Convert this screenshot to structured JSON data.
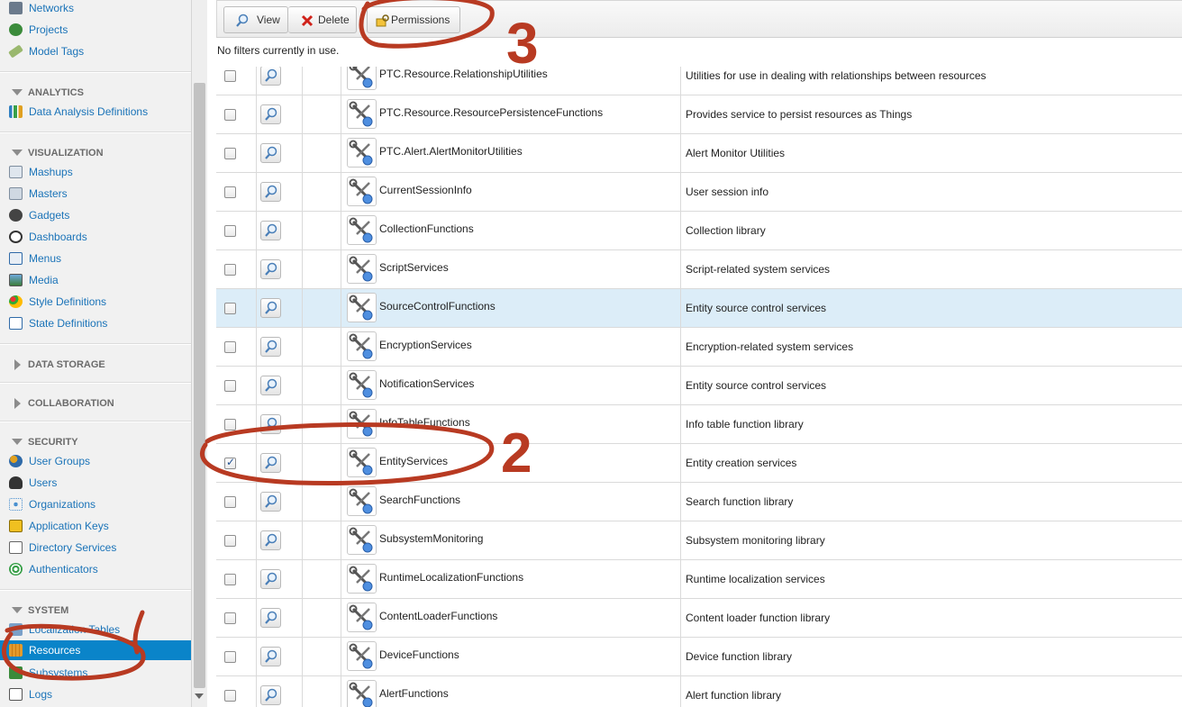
{
  "sidebar": {
    "top_items": [
      {
        "label": "Networks",
        "icon": "networks-icon"
      },
      {
        "label": "Projects",
        "icon": "projects-icon"
      },
      {
        "label": "Model Tags",
        "icon": "model-tags-icon"
      }
    ],
    "analytics": {
      "title": "ANALYTICS",
      "items": [
        {
          "label": "Data Analysis Definitions",
          "icon": "data-analysis-icon"
        }
      ]
    },
    "visualization": {
      "title": "VISUALIZATION",
      "items": [
        {
          "label": "Mashups",
          "icon": "mashups-icon"
        },
        {
          "label": "Masters",
          "icon": "masters-icon"
        },
        {
          "label": "Gadgets",
          "icon": "gadgets-icon"
        },
        {
          "label": "Dashboards",
          "icon": "dashboards-icon"
        },
        {
          "label": "Menus",
          "icon": "menus-icon"
        },
        {
          "label": "Media",
          "icon": "media-icon"
        },
        {
          "label": "Style Definitions",
          "icon": "style-definitions-icon"
        },
        {
          "label": "State Definitions",
          "icon": "state-definitions-icon"
        }
      ]
    },
    "data_storage": {
      "title": "DATA STORAGE"
    },
    "collaboration": {
      "title": "COLLABORATION"
    },
    "security": {
      "title": "SECURITY",
      "items": [
        {
          "label": "User Groups",
          "icon": "user-groups-icon"
        },
        {
          "label": "Users",
          "icon": "users-icon"
        },
        {
          "label": "Organizations",
          "icon": "organizations-icon"
        },
        {
          "label": "Application Keys",
          "icon": "application-keys-icon"
        },
        {
          "label": "Directory Services",
          "icon": "directory-services-icon"
        },
        {
          "label": "Authenticators",
          "icon": "authenticators-icon"
        }
      ]
    },
    "system": {
      "title": "SYSTEM",
      "items": [
        {
          "label": "Localization Tables",
          "icon": "localization-tables-icon"
        },
        {
          "label": "Resources",
          "icon": "resources-icon",
          "selected": true
        },
        {
          "label": "Subsystems",
          "icon": "subsystems-icon"
        },
        {
          "label": "Logs",
          "icon": "logs-icon"
        }
      ]
    }
  },
  "toolbar": {
    "view_label": "View",
    "delete_label": "Delete",
    "permissions_label": "Permissions"
  },
  "filter_text": "No filters currently in use.",
  "rows": [
    {
      "name": "PTC.Resource.RelationshipUtilities",
      "description": "Utilities for use in dealing with relationships between resources",
      "checked": false
    },
    {
      "name": "PTC.Resource.ResourcePersistenceFunctions",
      "description": "Provides service to persist resources as Things",
      "checked": false
    },
    {
      "name": "PTC.Alert.AlertMonitorUtilities",
      "description": "Alert Monitor Utilities",
      "checked": false
    },
    {
      "name": "CurrentSessionInfo",
      "description": "User session info",
      "checked": false
    },
    {
      "name": "CollectionFunctions",
      "description": "Collection library",
      "checked": false
    },
    {
      "name": "ScriptServices",
      "description": "Script-related system services",
      "checked": false
    },
    {
      "name": "SourceControlFunctions",
      "description": "Entity source control services",
      "checked": false,
      "hover": true
    },
    {
      "name": "EncryptionServices",
      "description": "Encryption-related system services",
      "checked": false
    },
    {
      "name": "NotificationServices",
      "description": "Entity source control services",
      "checked": false
    },
    {
      "name": "InfoTableFunctions",
      "description": "Info table function library",
      "checked": false
    },
    {
      "name": "EntityServices",
      "description": "Entity creation services",
      "checked": true
    },
    {
      "name": "SearchFunctions",
      "description": "Search function library",
      "checked": false
    },
    {
      "name": "SubsystemMonitoring",
      "description": "Subsystem monitoring library",
      "checked": false
    },
    {
      "name": "RuntimeLocalizationFunctions",
      "description": "Runtime localization services",
      "checked": false
    },
    {
      "name": "ContentLoaderFunctions",
      "description": "Content loader function library",
      "checked": false
    },
    {
      "name": "DeviceFunctions",
      "description": "Device function library",
      "checked": false
    },
    {
      "name": "AlertFunctions",
      "description": "Alert function library",
      "checked": false
    }
  ],
  "annotations": {
    "label_2": "2",
    "label_3": "3",
    "color": "#b83a22"
  }
}
